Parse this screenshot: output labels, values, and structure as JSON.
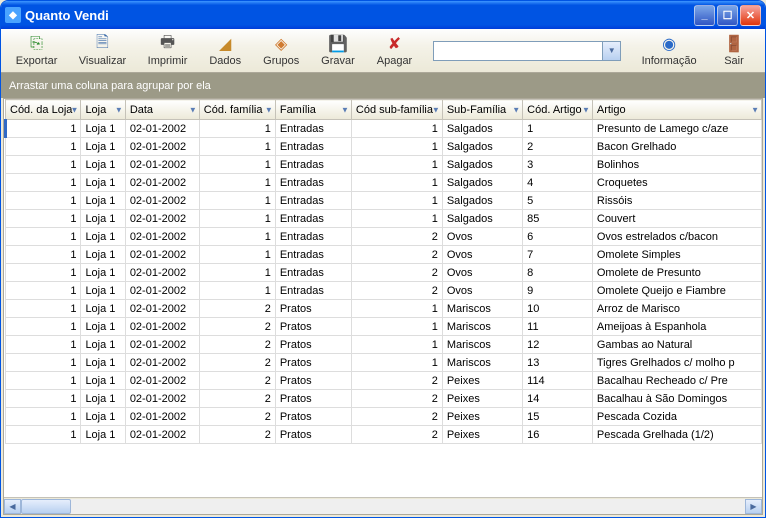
{
  "window": {
    "title": "Quanto Vendi"
  },
  "toolbar": {
    "exportar": "Exportar",
    "visualizar": "Visualizar",
    "imprimir": "Imprimir",
    "dados": "Dados",
    "grupos": "Grupos",
    "gravar": "Gravar",
    "apagar": "Apagar",
    "informacao": "Informação",
    "sair": "Sair",
    "search_value": ""
  },
  "groupbar": {
    "hint": "Arrastar uma coluna para agrupar por ela"
  },
  "columns": [
    "Cód. da Loja",
    "Loja",
    "Data",
    "Cód. família",
    "Família",
    "Cód sub-família",
    "Sub-Família",
    "Cód. Artigo",
    "Artigo"
  ],
  "rows": [
    {
      "codLoja": "1",
      "loja": "Loja 1",
      "data": "02-01-2002",
      "codFam": "1",
      "fam": "Entradas",
      "codSub": "1",
      "sub": "Salgados",
      "codArt": "1",
      "art": "Presunto de Lamego c/aze"
    },
    {
      "codLoja": "1",
      "loja": "Loja 1",
      "data": "02-01-2002",
      "codFam": "1",
      "fam": "Entradas",
      "codSub": "1",
      "sub": "Salgados",
      "codArt": "2",
      "art": "Bacon Grelhado"
    },
    {
      "codLoja": "1",
      "loja": "Loja 1",
      "data": "02-01-2002",
      "codFam": "1",
      "fam": "Entradas",
      "codSub": "1",
      "sub": "Salgados",
      "codArt": "3",
      "art": "Bolinhos"
    },
    {
      "codLoja": "1",
      "loja": "Loja 1",
      "data": "02-01-2002",
      "codFam": "1",
      "fam": "Entradas",
      "codSub": "1",
      "sub": "Salgados",
      "codArt": "4",
      "art": "Croquetes"
    },
    {
      "codLoja": "1",
      "loja": "Loja 1",
      "data": "02-01-2002",
      "codFam": "1",
      "fam": "Entradas",
      "codSub": "1",
      "sub": "Salgados",
      "codArt": "5",
      "art": "Rissóis"
    },
    {
      "codLoja": "1",
      "loja": "Loja 1",
      "data": "02-01-2002",
      "codFam": "1",
      "fam": "Entradas",
      "codSub": "1",
      "sub": "Salgados",
      "codArt": "85",
      "art": "Couvert"
    },
    {
      "codLoja": "1",
      "loja": "Loja 1",
      "data": "02-01-2002",
      "codFam": "1",
      "fam": "Entradas",
      "codSub": "2",
      "sub": "Ovos",
      "codArt": "6",
      "art": "Ovos estrelados c/bacon"
    },
    {
      "codLoja": "1",
      "loja": "Loja 1",
      "data": "02-01-2002",
      "codFam": "1",
      "fam": "Entradas",
      "codSub": "2",
      "sub": "Ovos",
      "codArt": "7",
      "art": "Omolete Simples"
    },
    {
      "codLoja": "1",
      "loja": "Loja 1",
      "data": "02-01-2002",
      "codFam": "1",
      "fam": "Entradas",
      "codSub": "2",
      "sub": "Ovos",
      "codArt": "8",
      "art": "Omolete de Presunto"
    },
    {
      "codLoja": "1",
      "loja": "Loja 1",
      "data": "02-01-2002",
      "codFam": "1",
      "fam": "Entradas",
      "codSub": "2",
      "sub": "Ovos",
      "codArt": "9",
      "art": "Omolete Queijo e Fiambre"
    },
    {
      "codLoja": "1",
      "loja": "Loja 1",
      "data": "02-01-2002",
      "codFam": "2",
      "fam": "Pratos",
      "codSub": "1",
      "sub": "Mariscos",
      "codArt": "10",
      "art": "Arroz de Marisco"
    },
    {
      "codLoja": "1",
      "loja": "Loja 1",
      "data": "02-01-2002",
      "codFam": "2",
      "fam": "Pratos",
      "codSub": "1",
      "sub": "Mariscos",
      "codArt": "11",
      "art": "Ameijoas à Espanhola"
    },
    {
      "codLoja": "1",
      "loja": "Loja 1",
      "data": "02-01-2002",
      "codFam": "2",
      "fam": "Pratos",
      "codSub": "1",
      "sub": "Mariscos",
      "codArt": "12",
      "art": "Gambas ao Natural"
    },
    {
      "codLoja": "1",
      "loja": "Loja 1",
      "data": "02-01-2002",
      "codFam": "2",
      "fam": "Pratos",
      "codSub": "1",
      "sub": "Mariscos",
      "codArt": "13",
      "art": "Tigres Grelhados c/ molho p"
    },
    {
      "codLoja": "1",
      "loja": "Loja 1",
      "data": "02-01-2002",
      "codFam": "2",
      "fam": "Pratos",
      "codSub": "2",
      "sub": "Peixes",
      "codArt": "114",
      "art": "Bacalhau Recheado c/ Pre"
    },
    {
      "codLoja": "1",
      "loja": "Loja 1",
      "data": "02-01-2002",
      "codFam": "2",
      "fam": "Pratos",
      "codSub": "2",
      "sub": "Peixes",
      "codArt": "14",
      "art": "Bacalhau à São Domingos"
    },
    {
      "codLoja": "1",
      "loja": "Loja 1",
      "data": "02-01-2002",
      "codFam": "2",
      "fam": "Pratos",
      "codSub": "2",
      "sub": "Peixes",
      "codArt": "15",
      "art": "Pescada Cozida"
    },
    {
      "codLoja": "1",
      "loja": "Loja 1",
      "data": "02-01-2002",
      "codFam": "2",
      "fam": "Pratos",
      "codSub": "2",
      "sub": "Peixes",
      "codArt": "16",
      "art": "Pescada Grelhada (1/2)"
    }
  ]
}
